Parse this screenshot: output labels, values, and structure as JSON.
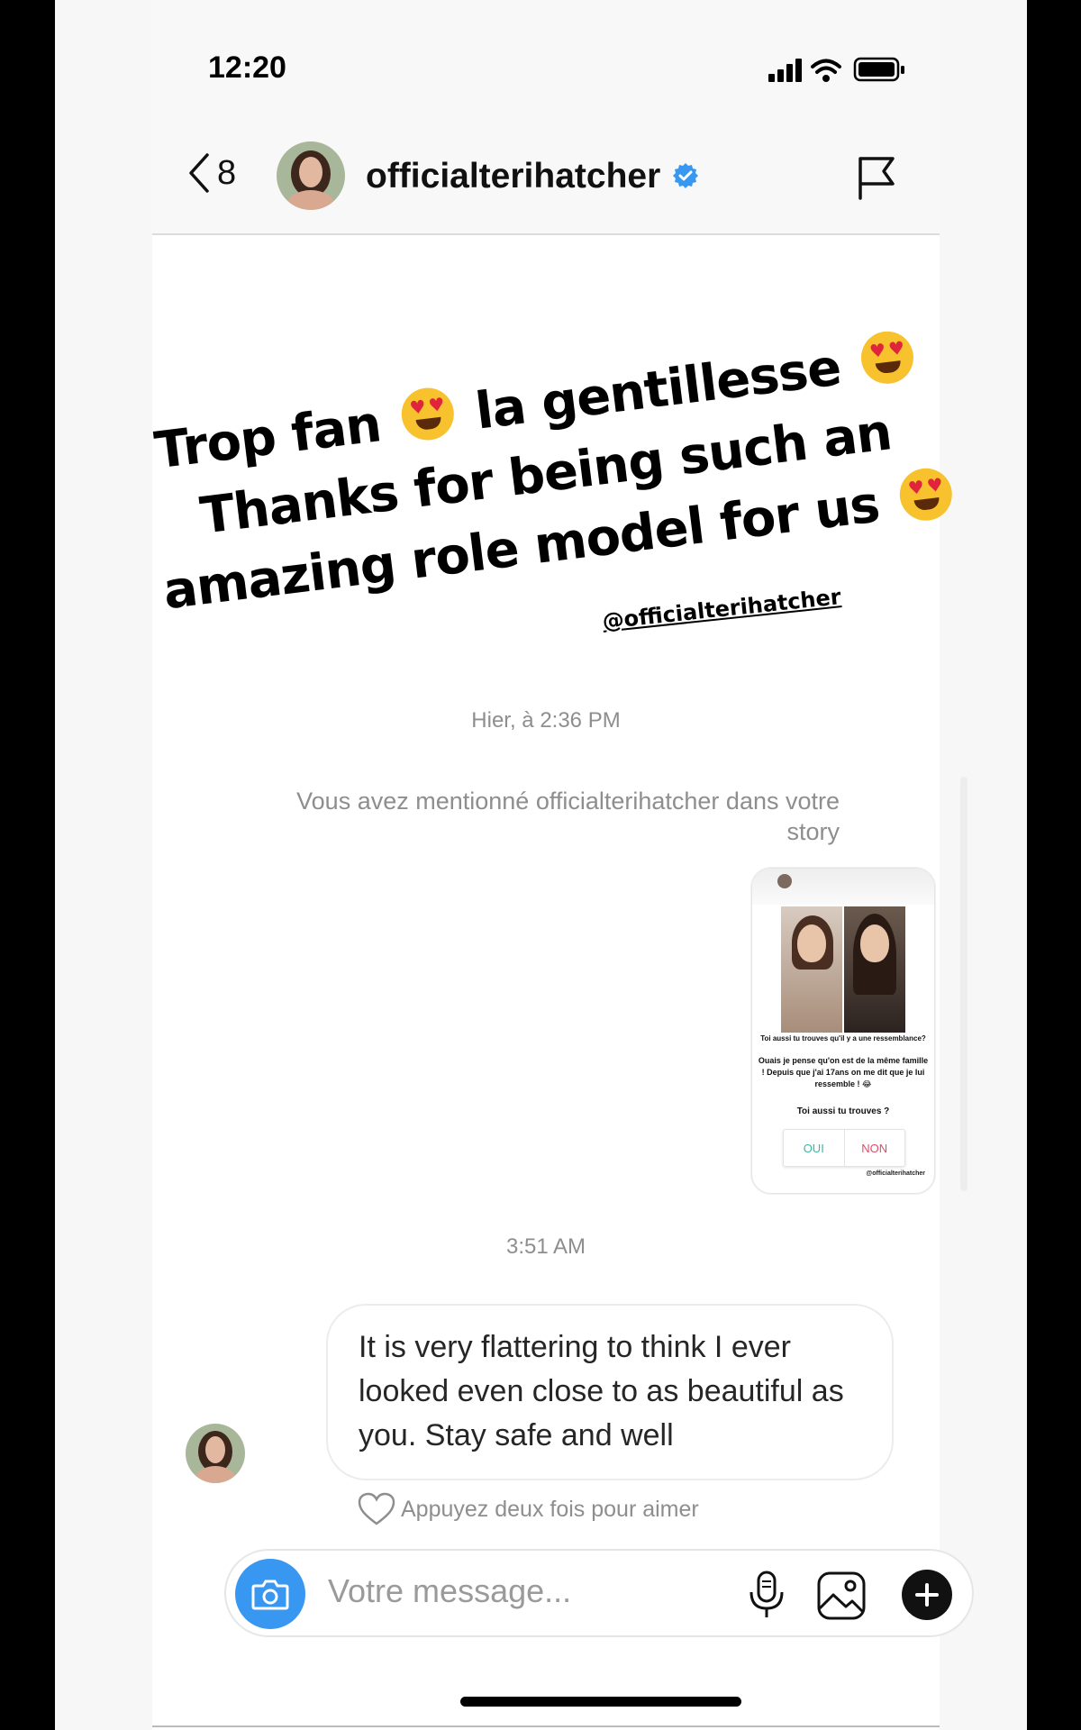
{
  "status_bar": {
    "time": "12:20"
  },
  "header": {
    "back_count": "8",
    "username": "officialterihatcher",
    "verified_color": "#3897f0"
  },
  "story": {
    "line1_a": "Trop fan",
    "line1_b": "la gentillesse",
    "line2": "Thanks for being such an",
    "line3": "amazing role model for us",
    "mention": "@officialterihatcher"
  },
  "conversation": {
    "timestamp1": "Hier, à 2:36 PM",
    "mention_note": "Vous avez mentionné officialterihatcher dans votre story",
    "story_card": {
      "question": "Toi aussi tu trouves qu'il y a une ressemblance?",
      "answer": "Ouais je pense qu'on est de la même famille ! Depuis que j'ai 17ans on me dit que je lui ressemble ! 😂",
      "prompt": "Toi aussi tu trouves ?",
      "poll_yes": "OUI",
      "poll_no": "NON",
      "credit": "@officialterihatcher"
    },
    "timestamp2": "3:51 AM",
    "reply": "It is very flattering to think I ever looked even close to as beautiful as you. Stay safe and well",
    "like_hint": "Appuyez deux fois pour aimer"
  },
  "composer": {
    "placeholder": "Votre message...",
    "camera_color": "#3897f0"
  }
}
